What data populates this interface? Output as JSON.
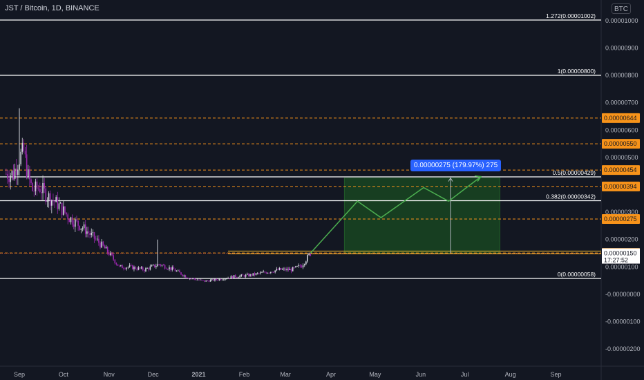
{
  "header": {
    "symbol_title": "JST / Bitcoin, 1D, BINANCE",
    "currency_badge": "BTC"
  },
  "colors": {
    "background": "#131722",
    "up": "#d1d4dc",
    "down": "#9c27b0",
    "fib": "#ffffff",
    "dashed": "#f7931a",
    "target_zone": "#1b5e20",
    "projection": "#4caf50",
    "measure": "#2962ff"
  },
  "chart_data": {
    "type": "candlestick",
    "title": "JST / Bitcoin, 1D, BINANCE",
    "xlabel": "",
    "ylabel": "",
    "x_ticks": [
      "Sep",
      "Oct",
      "Nov",
      "Dec",
      "2021",
      "Feb",
      "Mar",
      "Apr",
      "May",
      "Jun",
      "Jul",
      "Aug",
      "Sep"
    ],
    "y_ticks": [
      "0.00001000",
      "0.00000900",
      "0.00000800",
      "0.00000700",
      "0.00000600",
      "0.00000500",
      "0.00000400",
      "0.00000300",
      "0.00000200",
      "0.00000100",
      "-0.00000000",
      "-0.00000100",
      "-0.00000200"
    ],
    "ylim": [
      -2.4e-06,
      1.05e-05
    ],
    "fib_levels": [
      {
        "label": "1.272(0.00001002)",
        "value": 1.002e-05
      },
      {
        "label": "1(0.00000800)",
        "value": 8e-06
      },
      {
        "label": "0.5(0.00000429)",
        "value": 4.29e-06
      },
      {
        "label": "0.382(0.00000342)",
        "value": 3.42e-06
      },
      {
        "label": "0(0.00000058)",
        "value": 5.8e-07
      }
    ],
    "dashed_levels": [
      {
        "label": "0.00000644",
        "value": 6.44e-06
      },
      {
        "label": "0.00000550",
        "value": 5.5e-06
      },
      {
        "label": "0.00000454",
        "value": 4.54e-06
      },
      {
        "label": "0.00000394",
        "value": 3.94e-06
      },
      {
        "label": "0.00000275",
        "value": 2.75e-06
      },
      {
        "label": "0.00000151",
        "value": 1.51e-06
      }
    ],
    "last_price": {
      "label": "0.00000150",
      "countdown": "17:27:52",
      "value": 1.5e-06
    },
    "measure_label": "0.00000275 (179.97%) 275",
    "close_series": [
      {
        "date": "2020-08-28",
        "close": 4.4e-06
      },
      {
        "date": "2020-09-01",
        "close": 5e-06
      },
      {
        "date": "2020-09-04",
        "close": 5.2e-06
      },
      {
        "date": "2020-09-07",
        "close": 4.3e-06
      },
      {
        "date": "2020-09-10",
        "close": 3.8e-06
      },
      {
        "date": "2020-09-15",
        "close": 3.9e-06
      },
      {
        "date": "2020-09-20",
        "close": 3.6e-06
      },
      {
        "date": "2020-09-27",
        "close": 3.3e-06
      },
      {
        "date": "2020-10-05",
        "close": 2.8e-06
      },
      {
        "date": "2020-10-15",
        "close": 2.4e-06
      },
      {
        "date": "2020-10-25",
        "close": 1.9e-06
      },
      {
        "date": "2020-11-01",
        "close": 1.5e-06
      },
      {
        "date": "2020-11-08",
        "close": 1e-06
      },
      {
        "date": "2020-11-15",
        "close": 1e-06
      },
      {
        "date": "2020-11-25",
        "close": 9e-07
      },
      {
        "date": "2020-12-05",
        "close": 1.1e-06
      },
      {
        "date": "2020-12-15",
        "close": 9e-07
      },
      {
        "date": "2020-12-25",
        "close": 6e-07
      },
      {
        "date": "2021-01-05",
        "close": 4.8e-07
      },
      {
        "date": "2021-01-15",
        "close": 5.5e-07
      },
      {
        "date": "2021-01-25",
        "close": 6.5e-07
      },
      {
        "date": "2021-02-05",
        "close": 7e-07
      },
      {
        "date": "2021-02-15",
        "close": 8e-07
      },
      {
        "date": "2021-02-25",
        "close": 9e-07
      },
      {
        "date": "2021-03-05",
        "close": 9e-07
      },
      {
        "date": "2021-03-12",
        "close": 1.05e-06
      },
      {
        "date": "2021-03-18",
        "close": 1.5e-06
      }
    ],
    "projection_path": [
      {
        "date": "2021-03-18",
        "value": 1.5e-06
      },
      {
        "date": "2021-04-19",
        "value": 3.4e-06
      },
      {
        "date": "2021-05-05",
        "value": 2.8e-06
      },
      {
        "date": "2021-06-03",
        "value": 3.9e-06
      },
      {
        "date": "2021-06-20",
        "value": 3.4e-06
      },
      {
        "date": "2021-07-12",
        "value": 4.3e-06
      }
    ],
    "target_zone": {
      "from": "2021-04-10",
      "to": "2021-07-25",
      "low": 1.5e-06,
      "high": 4.25e-06
    }
  }
}
